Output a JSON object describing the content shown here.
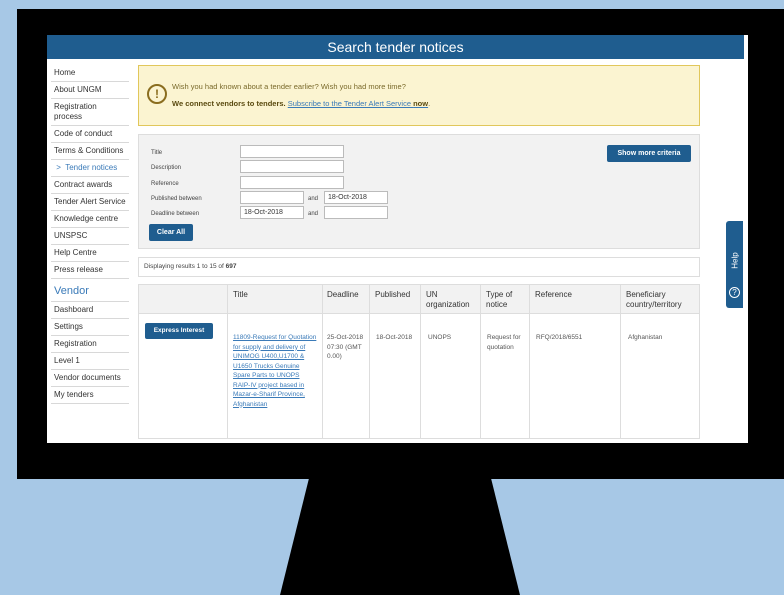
{
  "page_title": "Search tender notices",
  "sidebar": {
    "items": [
      {
        "label": "Home"
      },
      {
        "label": "About UNGM"
      },
      {
        "label": "Registration process"
      },
      {
        "label": "Code of conduct"
      },
      {
        "label": "Terms & Conditions"
      },
      {
        "label": "Tender notices",
        "active": true
      },
      {
        "label": "Contract awards"
      },
      {
        "label": "Tender Alert Service"
      },
      {
        "label": "Knowledge centre"
      },
      {
        "label": "UNSPSC"
      },
      {
        "label": "Help Centre"
      },
      {
        "label": "Press release"
      }
    ],
    "vendor_heading": "Vendor",
    "vendor_items": [
      {
        "label": "Dashboard"
      },
      {
        "label": "Settings"
      },
      {
        "label": "Registration"
      },
      {
        "label": "Level 1"
      },
      {
        "label": "Vendor documents"
      },
      {
        "label": "My tenders"
      }
    ]
  },
  "alert": {
    "line1": "Wish you had known about a tender earlier? Wish you had more time?",
    "line2_bold": "We connect vendors to tenders.",
    "link_text": "Subscribe to the Tender Alert Service",
    "link_bold": "now",
    "period": "."
  },
  "form": {
    "title_label": "Title",
    "description_label": "Description",
    "reference_label": "Reference",
    "published_label": "Published between",
    "deadline_label": "Deadline between",
    "and_label": "and",
    "published_from": "",
    "published_to": "18-Oct-2018",
    "deadline_from": "18-Oct-2018",
    "deadline_to": "",
    "clear_button": "Clear All",
    "more_button": "Show more criteria"
  },
  "results": {
    "prefix": "Displaying results 1 to 15 of",
    "total": "697"
  },
  "table": {
    "headers": [
      "Title",
      "Deadline",
      "Published",
      "UN organization",
      "Type of notice",
      "Reference",
      "Beneficiary country/territory"
    ],
    "rows": [
      {
        "action": "Express Interest",
        "title": "11809-Request for Quotation for supply and delivery of UNIMOG U400,U1700 & U1650 Trucks Genuine Spare Parts to UNOPS RAIP-IV project based in Mazar-e-Sharif Province, Afghanistan",
        "deadline": "25-Oct-2018 07:30 (GMT 0.00)",
        "published": "18-Oct-2018",
        "organization": "UNOPS",
        "type": "Request for quotation",
        "reference": "RFQ/2018/6551",
        "country": "Afghanistan"
      }
    ]
  },
  "help": {
    "label": "Help",
    "icon": "?"
  }
}
